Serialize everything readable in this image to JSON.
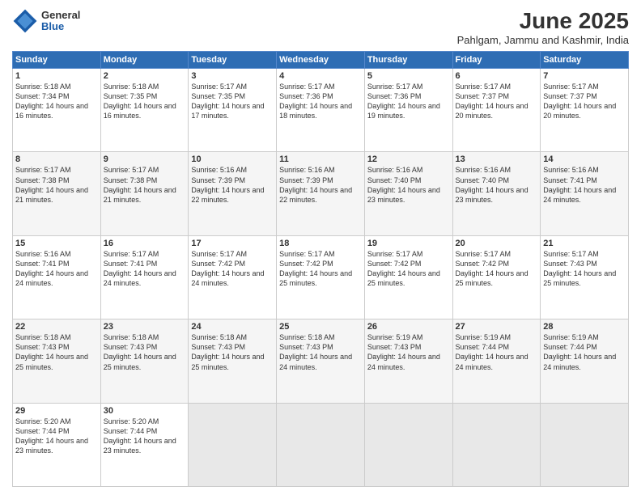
{
  "logo": {
    "general": "General",
    "blue": "Blue"
  },
  "title": "June 2025",
  "subtitle": "Pahlgam, Jammu and Kashmir, India",
  "headers": [
    "Sunday",
    "Monday",
    "Tuesday",
    "Wednesday",
    "Thursday",
    "Friday",
    "Saturday"
  ],
  "weeks": [
    [
      {
        "day": "1",
        "sunrise": "5:18 AM",
        "sunset": "7:34 PM",
        "daylight": "14 hours and 16 minutes."
      },
      {
        "day": "2",
        "sunrise": "5:18 AM",
        "sunset": "7:35 PM",
        "daylight": "14 hours and 16 minutes."
      },
      {
        "day": "3",
        "sunrise": "5:17 AM",
        "sunset": "7:35 PM",
        "daylight": "14 hours and 17 minutes."
      },
      {
        "day": "4",
        "sunrise": "5:17 AM",
        "sunset": "7:36 PM",
        "daylight": "14 hours and 18 minutes."
      },
      {
        "day": "5",
        "sunrise": "5:17 AM",
        "sunset": "7:36 PM",
        "daylight": "14 hours and 19 minutes."
      },
      {
        "day": "6",
        "sunrise": "5:17 AM",
        "sunset": "7:37 PM",
        "daylight": "14 hours and 20 minutes."
      },
      {
        "day": "7",
        "sunrise": "5:17 AM",
        "sunset": "7:37 PM",
        "daylight": "14 hours and 20 minutes."
      }
    ],
    [
      {
        "day": "8",
        "sunrise": "5:17 AM",
        "sunset": "7:38 PM",
        "daylight": "14 hours and 21 minutes."
      },
      {
        "day": "9",
        "sunrise": "5:17 AM",
        "sunset": "7:38 PM",
        "daylight": "14 hours and 21 minutes."
      },
      {
        "day": "10",
        "sunrise": "5:16 AM",
        "sunset": "7:39 PM",
        "daylight": "14 hours and 22 minutes."
      },
      {
        "day": "11",
        "sunrise": "5:16 AM",
        "sunset": "7:39 PM",
        "daylight": "14 hours and 22 minutes."
      },
      {
        "day": "12",
        "sunrise": "5:16 AM",
        "sunset": "7:40 PM",
        "daylight": "14 hours and 23 minutes."
      },
      {
        "day": "13",
        "sunrise": "5:16 AM",
        "sunset": "7:40 PM",
        "daylight": "14 hours and 23 minutes."
      },
      {
        "day": "14",
        "sunrise": "5:16 AM",
        "sunset": "7:41 PM",
        "daylight": "14 hours and 24 minutes."
      }
    ],
    [
      {
        "day": "15",
        "sunrise": "5:16 AM",
        "sunset": "7:41 PM",
        "daylight": "14 hours and 24 minutes."
      },
      {
        "day": "16",
        "sunrise": "5:17 AM",
        "sunset": "7:41 PM",
        "daylight": "14 hours and 24 minutes."
      },
      {
        "day": "17",
        "sunrise": "5:17 AM",
        "sunset": "7:42 PM",
        "daylight": "14 hours and 24 minutes."
      },
      {
        "day": "18",
        "sunrise": "5:17 AM",
        "sunset": "7:42 PM",
        "daylight": "14 hours and 25 minutes."
      },
      {
        "day": "19",
        "sunrise": "5:17 AM",
        "sunset": "7:42 PM",
        "daylight": "14 hours and 25 minutes."
      },
      {
        "day": "20",
        "sunrise": "5:17 AM",
        "sunset": "7:42 PM",
        "daylight": "14 hours and 25 minutes."
      },
      {
        "day": "21",
        "sunrise": "5:17 AM",
        "sunset": "7:43 PM",
        "daylight": "14 hours and 25 minutes."
      }
    ],
    [
      {
        "day": "22",
        "sunrise": "5:18 AM",
        "sunset": "7:43 PM",
        "daylight": "14 hours and 25 minutes."
      },
      {
        "day": "23",
        "sunrise": "5:18 AM",
        "sunset": "7:43 PM",
        "daylight": "14 hours and 25 minutes."
      },
      {
        "day": "24",
        "sunrise": "5:18 AM",
        "sunset": "7:43 PM",
        "daylight": "14 hours and 25 minutes."
      },
      {
        "day": "25",
        "sunrise": "5:18 AM",
        "sunset": "7:43 PM",
        "daylight": "14 hours and 24 minutes."
      },
      {
        "day": "26",
        "sunrise": "5:19 AM",
        "sunset": "7:43 PM",
        "daylight": "14 hours and 24 minutes."
      },
      {
        "day": "27",
        "sunrise": "5:19 AM",
        "sunset": "7:44 PM",
        "daylight": "14 hours and 24 minutes."
      },
      {
        "day": "28",
        "sunrise": "5:19 AM",
        "sunset": "7:44 PM",
        "daylight": "14 hours and 24 minutes."
      }
    ],
    [
      {
        "day": "29",
        "sunrise": "5:20 AM",
        "sunset": "7:44 PM",
        "daylight": "14 hours and 23 minutes."
      },
      {
        "day": "30",
        "sunrise": "5:20 AM",
        "sunset": "7:44 PM",
        "daylight": "14 hours and 23 minutes."
      },
      null,
      null,
      null,
      null,
      null
    ]
  ]
}
